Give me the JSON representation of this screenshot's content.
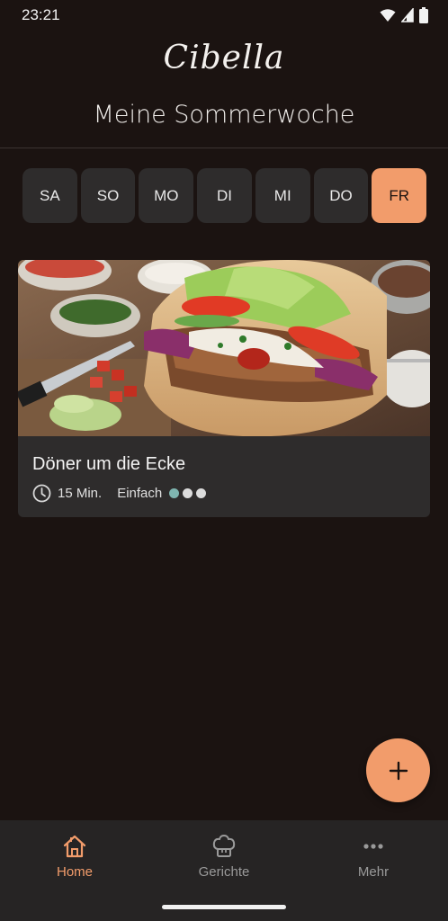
{
  "status_bar": {
    "time": "23:21",
    "icons": [
      "wifi-icon",
      "cellular-signal-icon",
      "battery-icon"
    ]
  },
  "app": {
    "logo_text": "Cibella",
    "title": "Meine Sommerwoche"
  },
  "day_tabs": [
    {
      "label": "SA",
      "selected": false
    },
    {
      "label": "SO",
      "selected": false
    },
    {
      "label": "MO",
      "selected": false
    },
    {
      "label": "DI",
      "selected": false
    },
    {
      "label": "MI",
      "selected": false
    },
    {
      "label": "DO",
      "selected": false
    },
    {
      "label": "FR",
      "selected": true
    }
  ],
  "recipe": {
    "title": "Döner um die Ecke",
    "time": "15 Min.",
    "difficulty": "Einfach",
    "difficulty_level": 1,
    "difficulty_max": 3,
    "image_icon": "doner-kebab-photo"
  },
  "fab": {
    "icon": "plus-icon"
  },
  "bottom_nav": [
    {
      "label": "Home",
      "icon": "home-icon",
      "active": true
    },
    {
      "label": "Gerichte",
      "icon": "chef-hat-icon",
      "active": false
    },
    {
      "label": "Mehr",
      "icon": "more-horizontal-icon",
      "active": false
    }
  ],
  "colors": {
    "background": "#1b1311",
    "surface": "#2e2c2c",
    "accent": "#f29c6b",
    "difficulty_filled": "#7fb5b0",
    "nav_background": "#262424"
  }
}
